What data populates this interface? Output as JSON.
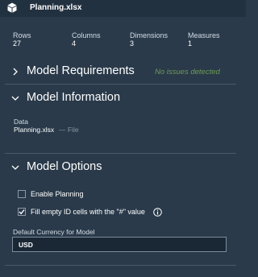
{
  "header": {
    "title": "Planning.xlsx",
    "icon": "cube-icon"
  },
  "stats": [
    {
      "label": "Rows",
      "value": "27"
    },
    {
      "label": "Columns",
      "value": "4"
    },
    {
      "label": "Dimensions",
      "value": "3"
    },
    {
      "label": "Measures",
      "value": "1"
    }
  ],
  "sections": {
    "requirements": {
      "label": "Model Requirements",
      "status": "No issues detected",
      "expanded": false
    },
    "information": {
      "label": "Model Information",
      "expanded": true,
      "data_label": "Data",
      "file_name": "Planning.xlsx",
      "file_type": "— File"
    },
    "options": {
      "label": "Model Options",
      "expanded": true,
      "enable_planning": {
        "label": "Enable Planning",
        "checked": false
      },
      "fill_empty": {
        "label": "Fill empty ID cells with the \"#\" value",
        "checked": true
      },
      "currency_label": "Default Currency for Model",
      "currency_value": "USD"
    }
  },
  "colors": {
    "background": "#2a3a4a",
    "header": "#223140",
    "status_ok": "#6e9a55",
    "muted_text": "#8a97a3"
  }
}
